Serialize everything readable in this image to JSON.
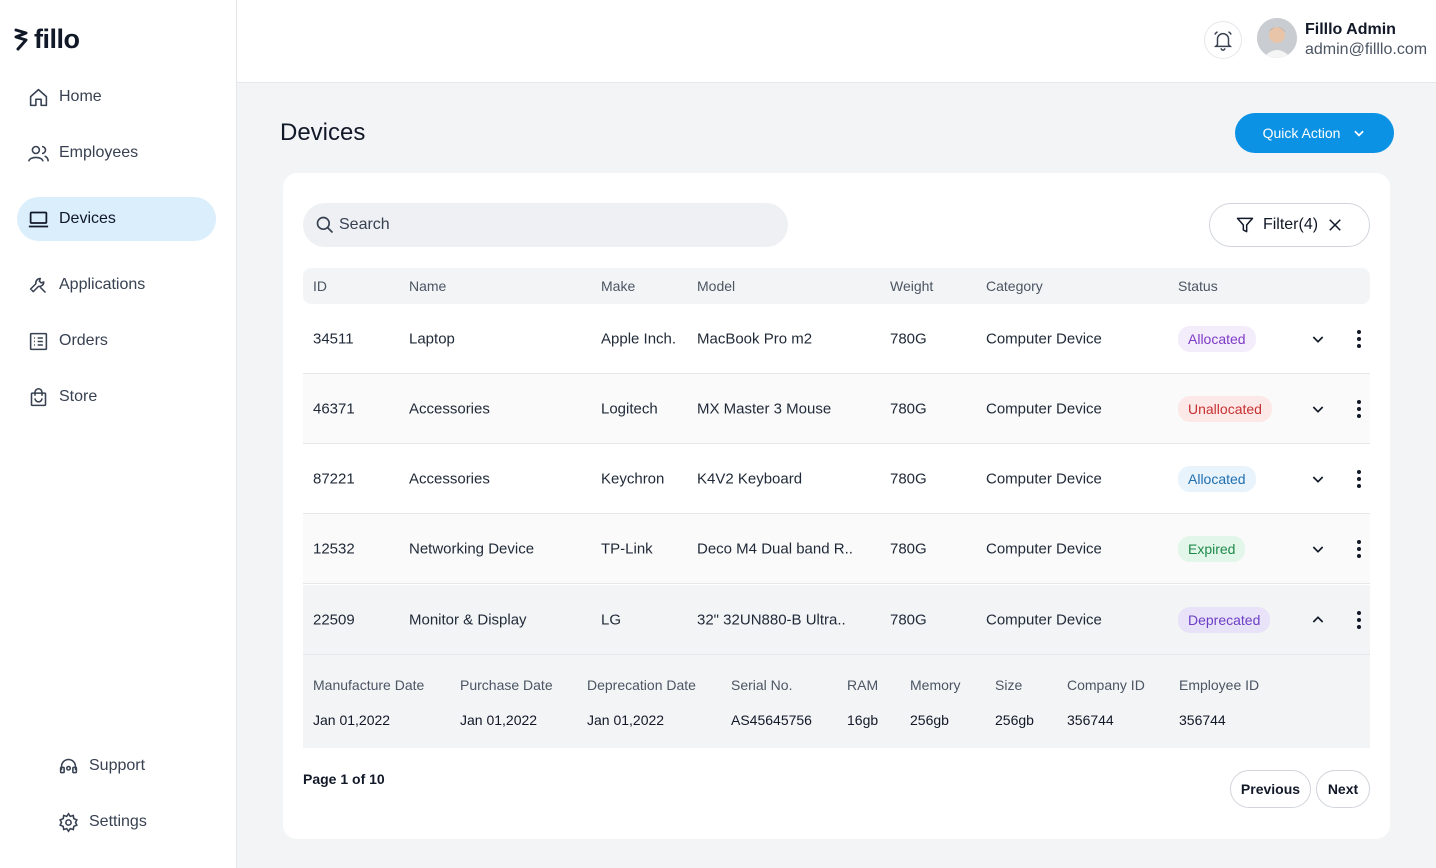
{
  "brand": {
    "name": "fillo"
  },
  "sidebar": {
    "items": [
      {
        "label": "Home",
        "icon": "home-icon"
      },
      {
        "label": "Employees",
        "icon": "users-icon"
      },
      {
        "label": "Devices",
        "icon": "laptop-icon",
        "active": true
      },
      {
        "label": "Applications",
        "icon": "wrench-icon"
      },
      {
        "label": "Orders",
        "icon": "list-icon"
      },
      {
        "label": "Store",
        "icon": "bag-icon"
      }
    ],
    "footer": [
      {
        "label": "Support",
        "icon": "headset-icon"
      },
      {
        "label": "Settings",
        "icon": "gear-icon"
      }
    ]
  },
  "header": {
    "user_name": "Filllo Admin",
    "user_email": "admin@filllo.com"
  },
  "page": {
    "title": "Devices",
    "quick_action": "Quick Action"
  },
  "search": {
    "placeholder": "Search"
  },
  "filter": {
    "label": "Filter(4)"
  },
  "table": {
    "columns": [
      "ID",
      "Name",
      "Make",
      "Model",
      "Weight",
      "Category",
      "Status"
    ],
    "rows": [
      {
        "id": "34511",
        "name": "Laptop",
        "make": "Apple Inch.",
        "model": "MacBook Pro m2",
        "weight": "780G",
        "category": "Computer Device",
        "status": "Allocated"
      },
      {
        "id": "46371",
        "name": "Accessories",
        "make": "Logitech",
        "model": "MX Master 3 Mouse",
        "weight": "780G",
        "category": "Computer Device",
        "status": "Unallocated"
      },
      {
        "id": "87221",
        "name": "Accessories",
        "make": "Keychron",
        "model": "K4V2 Keyboard",
        "weight": "780G",
        "category": "Computer Device",
        "status": "Allocated"
      },
      {
        "id": "12532",
        "name": "Networking Device",
        "make": "TP-Link",
        "model": "Deco M4 Dual band R..",
        "weight": "780G",
        "category": "Computer Device",
        "status": "Expired"
      },
      {
        "id": "22509",
        "name": "Monitor & Display",
        "make": "LG",
        "model": "32\" 32UN880-B Ultra..",
        "weight": "780G",
        "category": "Computer Device",
        "status": "Deprecated"
      }
    ]
  },
  "details": {
    "headers": [
      "Manufacture Date",
      "Purchase Date",
      "Deprecation Date",
      "Serial No.",
      "RAM",
      "Memory",
      "Size",
      "Company ID",
      "Employee ID"
    ],
    "values": [
      "Jan 01,2022",
      "Jan 01,2022",
      "Jan 01,2022",
      "AS45645756",
      "16gb",
      "256gb",
      "256gb",
      "356744",
      "356744"
    ]
  },
  "pagination": {
    "info": "Page 1 of 10",
    "previous": "Previous",
    "next": "Next"
  },
  "colors": {
    "accent": "#0b92e5",
    "active_nav": "#dbeefc",
    "allocated_bg": "#e8f3fc",
    "allocated_fg": "#1f6fb0",
    "allocated_alt_bg": "#f3ecfb",
    "allocated_alt_fg": "#7e3bc7",
    "unallocated_bg": "#fde8e8",
    "unallocated_fg": "#c53030",
    "expired_bg": "#e3f6ea",
    "expired_fg": "#1e8a4a",
    "deprecated_bg": "#efe9fb",
    "deprecated_fg": "#6d3fc4"
  }
}
